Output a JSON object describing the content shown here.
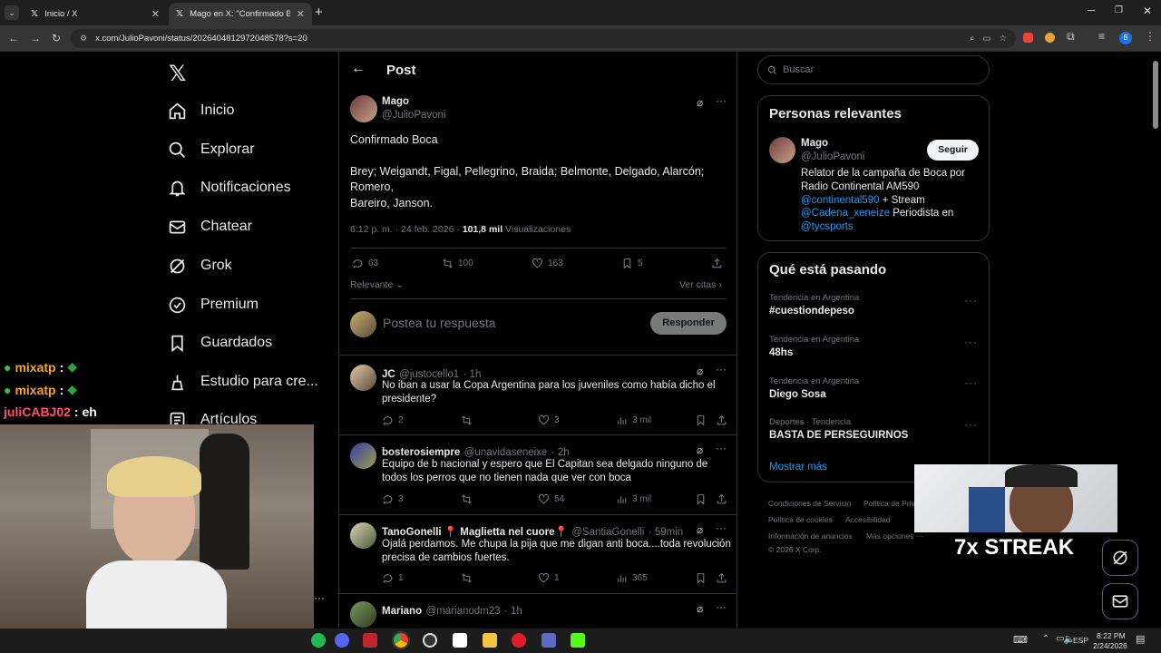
{
  "browser": {
    "tabs": [
      {
        "title": "Inicio / X",
        "active": false
      },
      {
        "title": "Mago en X: \"Confirmado Boca",
        "active": true
      }
    ],
    "url": "x.com/JulioPavoni/status/2026404812972048578?s=20"
  },
  "sidebar": {
    "items": [
      {
        "label": "Inicio",
        "icon": "home-icon"
      },
      {
        "label": "Explorar",
        "icon": "search-icon"
      },
      {
        "label": "Notificaciones",
        "icon": "bell-icon"
      },
      {
        "label": "Chatear",
        "icon": "mail-icon"
      },
      {
        "label": "Grok",
        "icon": "grok-icon"
      },
      {
        "label": "Premium",
        "icon": "verified-icon"
      },
      {
        "label": "Guardados",
        "icon": "bookmark-icon"
      },
      {
        "label": "Estudio para cre...",
        "icon": "studio-icon"
      },
      {
        "label": "Artículos",
        "icon": "article-icon"
      }
    ]
  },
  "main": {
    "header": "Post",
    "post": {
      "author": "Mago",
      "handle": "@JulioPavoni",
      "line1": "Confirmado Boca",
      "line2": "Brey; Weigandt, Figal, Pellegrino, Braida; Belmonte, Delgado, Alarcón;",
      "line3": "Romero,",
      "line4": "Bareiro, Janson.",
      "time": "6:12 p. m. · 24 feb. 2026 ·",
      "views": "101,8 mil",
      "views_label": "Visualizaciones",
      "replies": "63",
      "reposts": "100",
      "likes": "163",
      "bookmarks": "5",
      "sort": "Relevante",
      "quotes": "Ver citas"
    },
    "composer": {
      "placeholder": "Postea tu respuesta",
      "button": "Responder"
    },
    "replies": [
      {
        "name": "JC",
        "handle": "@justocello1",
        "time": "· 1h",
        "text": "No iban a usar la Copa Argentina para los juveniles como había dicho el presidente?",
        "replies": "2",
        "reposts": "",
        "likes": "3",
        "views": "3 mil"
      },
      {
        "name": "bosterosiempre",
        "handle": "@unavidaseneixe",
        "time": "· 2h",
        "text": "Equipo de b nacional y espero que El Capitan sea delgado ninguno de todos los perros que no tienen nada que ver con boca",
        "replies": "3",
        "reposts": "",
        "likes": "54",
        "views": "3 mil"
      },
      {
        "name": "TanoGonelli 📍 Maglietta nel cuore📍",
        "handle": "@SantiaGonelli",
        "time": "· 59min",
        "text": "Ojalá perdamos. Me chupa la pija que me digan anti boca....toda revolución precisa de cambios fuertes.",
        "replies": "1",
        "reposts": "",
        "likes": "1",
        "views": "365"
      },
      {
        "name": "Mariano",
        "handle": "@marianodm23",
        "time": "· 1h",
        "text": "",
        "replies": "",
        "reposts": "",
        "likes": "",
        "views": ""
      }
    ]
  },
  "right": {
    "search_placeholder": "Buscar",
    "relevant": {
      "title": "Personas relevantes",
      "name": "Mago",
      "handle": "@JulioPavoni",
      "follow": "Seguir",
      "bio1": "Relator de la campaña de Boca por",
      "bio2": "Radio Continental AM590",
      "bio3a": "@continental590",
      "bio3b": " + Stream",
      "bio4a": "@Cadena_xeneize",
      "bio4b": " Periodista en",
      "bio5": "@tycsports"
    },
    "trends": {
      "title": "Qué está pasando",
      "items": [
        {
          "category": "Tendencia en Argentina",
          "title": "#cuestiondepeso"
        },
        {
          "category": "Tendencia en Argentina",
          "title": "48hs"
        },
        {
          "category": "Tendencia en Argentina",
          "title": "Diego Sosa"
        },
        {
          "category": "Deportes · Tendencia",
          "title": "BASTA DE PERSEGUIRNOS"
        }
      ],
      "more": "Mostrar más"
    },
    "footer": {
      "l1a": "Condiciones de Servicio",
      "l1b": "Política de Priv",
      "l2a": "Política de cookies",
      "l2b": "Accesibilidad",
      "l3a": "Información de anuncios",
      "l3b": "Más opciones ···",
      "copy": "© 2026 X Corp."
    }
  },
  "overlay": {
    "chat": [
      {
        "user": "mixatp",
        "msg": ":",
        "color": "#f5a623"
      },
      {
        "user": "mixatp",
        "msg": ":",
        "color": "#f5a623"
      },
      {
        "user": "juliCABJ02",
        "msg": ": eh",
        "color": "#ff4f6d"
      }
    ],
    "streak": "7x STREAK"
  },
  "taskbar": {
    "lang": "ESP",
    "time": "8:22 PM",
    "date": "2/24/2026"
  },
  "colors": {
    "accent": "#1d9bf0",
    "background": "#000000",
    "border": "#2f3336"
  }
}
